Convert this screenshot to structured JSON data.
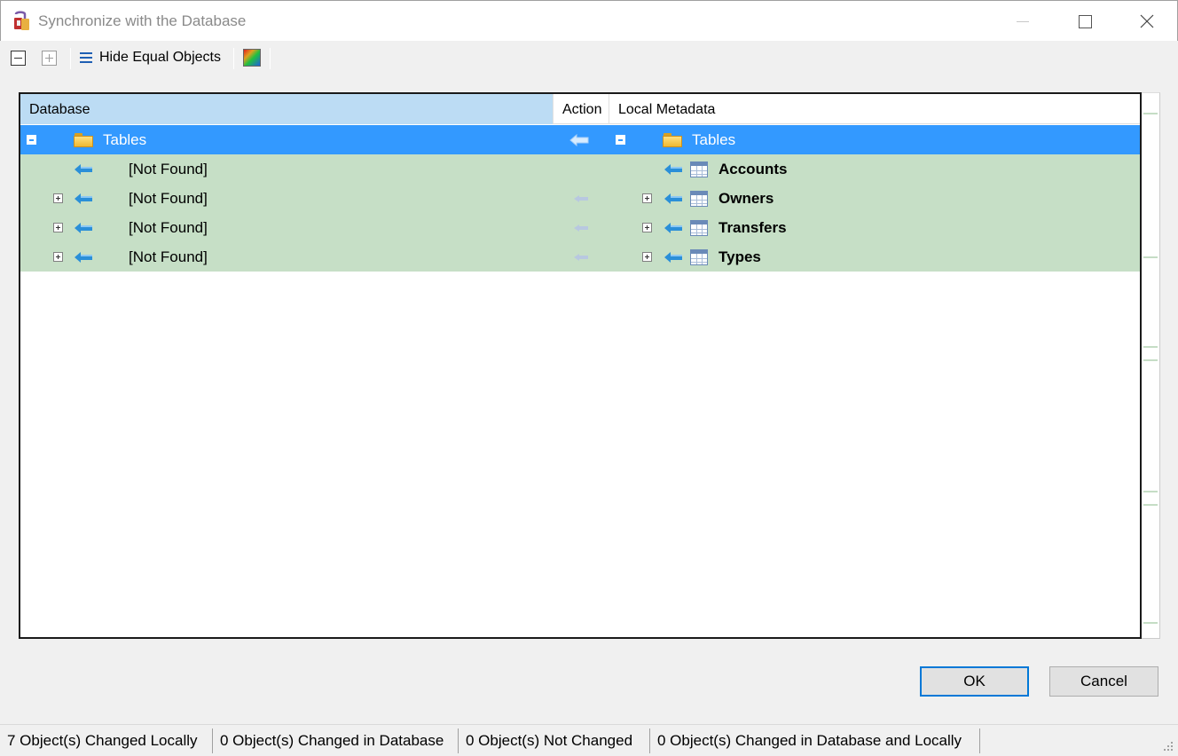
{
  "window": {
    "title": "Synchronize with the Database",
    "icon": "database-sync-icon"
  },
  "toolbar": {
    "collapse_icon": "collapse-all-icon",
    "expand_icon": "expand-all-icon",
    "hide_equal_label": "Hide Equal Objects",
    "color_icon": "color-legend-icon"
  },
  "grid": {
    "headers": {
      "database": "Database",
      "action": "Action",
      "local": "Local Metadata"
    },
    "root": {
      "db_label": "Tables",
      "local_label": "Tables"
    },
    "rows": [
      {
        "db": "[Not Found]",
        "local": "Accounts",
        "expandable": false
      },
      {
        "db": "[Not Found]",
        "local": "Owners",
        "expandable": true
      },
      {
        "db": "[Not Found]",
        "local": "Transfers",
        "expandable": true
      },
      {
        "db": "[Not Found]",
        "local": "Types",
        "expandable": true
      }
    ]
  },
  "buttons": {
    "ok": "OK",
    "cancel": "Cancel"
  },
  "status": {
    "changed_locally": "7 Object(s) Changed Locally",
    "changed_db": "0 Object(s) Changed in Database",
    "not_changed": "0 Object(s) Not Changed",
    "changed_both": "0 Object(s) Changed in Database and Locally"
  },
  "colors": {
    "selection": "#3399ff",
    "changed_row": "#c6dfc6",
    "header_db": "#bcdcf4",
    "arrow": "#2a8fd8"
  }
}
